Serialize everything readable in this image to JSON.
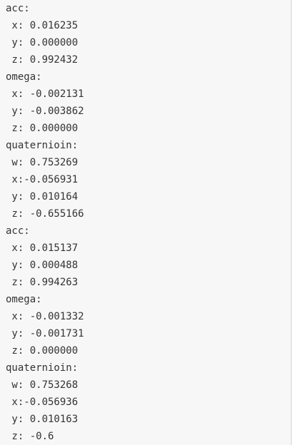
{
  "console": {
    "lines": [
      "acc:",
      " x: 0.016235",
      " y: 0.000000",
      " z: 0.992432",
      "omega:",
      " x: -0.002131",
      " y: -0.003862",
      " z: 0.000000",
      "quaternioin:",
      " w: 0.753269",
      " x:-0.056931",
      " y: 0.010164",
      " z: -0.655166",
      "acc:",
      " x: 0.015137",
      " y: 0.000488",
      " z: 0.994263",
      "omega:",
      " x: -0.001332",
      " y: -0.001731",
      " z: 0.000000",
      "quaternioin:",
      " w: 0.753268",
      " x:-0.056936",
      " y: 0.010163",
      " z: -0.6"
    ]
  }
}
